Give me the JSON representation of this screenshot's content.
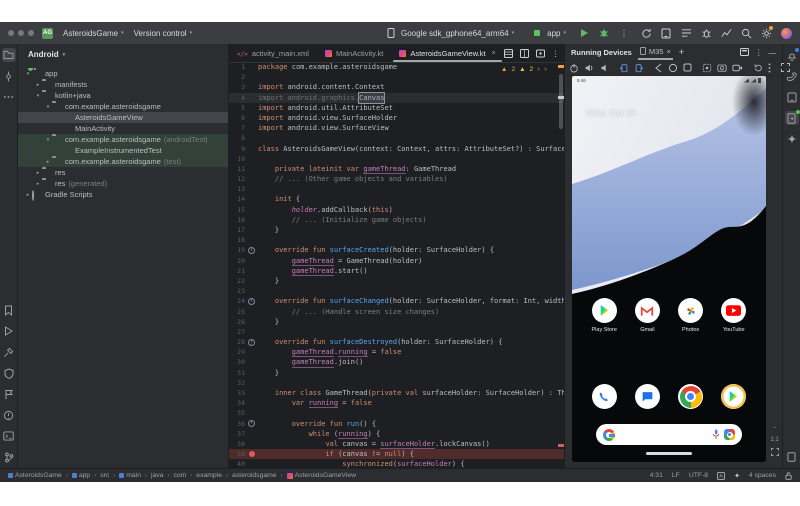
{
  "window": {
    "project": "AsteroidsGame",
    "vcs": "Version control"
  },
  "toolbar": {
    "device": "Google sdk_gphone64_arm64",
    "config": "app",
    "right_icons": [
      "sync",
      "device-manager",
      "build-variants",
      "bug-report",
      "profiler",
      "search",
      "settings"
    ]
  },
  "left_strip": {
    "top": [
      "project",
      "commit",
      "more-tools"
    ],
    "bottom": [
      "bookmarks",
      "run",
      "build",
      "app-quality-insights",
      "logcat",
      "problems",
      "terminal",
      "version-control"
    ]
  },
  "right_strip": {
    "top": [
      "notifications",
      "gradle",
      "device-manager",
      "running-devices",
      "gemini"
    ],
    "bottom": [
      "device-explorer"
    ]
  },
  "project_panel": {
    "title": "Android",
    "tree": [
      {
        "label": "app",
        "meta": "",
        "depth": 0,
        "icon": "app",
        "chev": "open"
      },
      {
        "label": "manifests",
        "meta": "",
        "depth": 1,
        "icon": "folder",
        "chev": "closed"
      },
      {
        "label": "kotlin+java",
        "meta": "",
        "depth": 1,
        "icon": "folder",
        "chev": "open"
      },
      {
        "label": "com.example.asteroidsgame",
        "meta": "",
        "depth": 2,
        "icon": "folder",
        "chev": "open"
      },
      {
        "label": "AsteroidsGameView",
        "meta": "",
        "depth": 3,
        "icon": "kotlin",
        "chev": "",
        "selected": true
      },
      {
        "label": "MainActivity",
        "meta": "",
        "depth": 3,
        "icon": "kotlin",
        "chev": ""
      },
      {
        "label": "com.example.asteroidsgame",
        "meta": "(androidTest)",
        "depth": 2,
        "icon": "folder",
        "chev": "open",
        "test": true
      },
      {
        "label": "ExampleInstrumentedTest",
        "meta": "",
        "depth": 3,
        "icon": "kotlin",
        "chev": "",
        "test": true
      },
      {
        "label": "com.example.asteroidsgame",
        "meta": "(test)",
        "depth": 2,
        "icon": "folder",
        "chev": "closed",
        "test": true
      },
      {
        "label": "res",
        "meta": "",
        "depth": 1,
        "icon": "res",
        "chev": "closed"
      },
      {
        "label": "res",
        "meta": "(generated)",
        "depth": 1,
        "icon": "res",
        "chev": "closed"
      },
      {
        "label": "Gradle Scripts",
        "meta": "",
        "depth": 0,
        "icon": "gradle",
        "chev": "closed"
      }
    ]
  },
  "editor": {
    "tabs": [
      {
        "label": "activity_main.xml",
        "icon": "xml",
        "active": false
      },
      {
        "label": "MainActivity.kt",
        "icon": "kotlin",
        "active": false
      },
      {
        "label": "AsteroidsGameView.kt",
        "icon": "kotlin",
        "active": true,
        "close": "×"
      }
    ],
    "inspections": {
      "warnings": "2",
      "weak_warnings": "2"
    },
    "code": {
      "lines": [
        {
          "n": "1",
          "seg": [
            [
              "k",
              "package"
            ],
            [
              "d",
              " com.example.asteroidsgame"
            ]
          ]
        },
        {
          "n": "2",
          "seg": []
        },
        {
          "n": "3",
          "seg": [
            [
              "k",
              "import"
            ],
            [
              "d",
              " android.content.Context"
            ]
          ]
        },
        {
          "n": "4",
          "hl": "cur",
          "seg": [
            [
              "g",
              "import android.graphics."
            ],
            [
              "gb",
              "Canvas"
            ]
          ]
        },
        {
          "n": "5",
          "seg": [
            [
              "k",
              "import"
            ],
            [
              "d",
              " android.util.AttributeSet"
            ]
          ]
        },
        {
          "n": "6",
          "seg": [
            [
              "k",
              "import"
            ],
            [
              "d",
              " android.view.SurfaceHolder"
            ]
          ]
        },
        {
          "n": "7",
          "seg": [
            [
              "k",
              "import"
            ],
            [
              "d",
              " android.view.SurfaceView"
            ]
          ]
        },
        {
          "n": "8",
          "seg": []
        },
        {
          "n": "9",
          "seg": [
            [
              "k",
              "class"
            ],
            [
              "d",
              " AsteroidsGameView(context: Context, attrs: AttributeSet?) : SurfaceView(context, attrs), SurfaceHolder.Callback {"
            ]
          ]
        },
        {
          "n": "10",
          "seg": []
        },
        {
          "n": "11",
          "seg": [
            [
              "d",
              "    "
            ],
            [
              "k",
              "private lateinit var "
            ],
            [
              "p",
              "gameThread"
            ],
            [
              "d",
              ": GameThread"
            ]
          ]
        },
        {
          "n": "12",
          "seg": [
            [
              "c",
              "    // ... (Other game objects and variables)"
            ]
          ]
        },
        {
          "n": "13",
          "seg": []
        },
        {
          "n": "14",
          "seg": [
            [
              "d",
              "    "
            ],
            [
              "k",
              "init"
            ],
            [
              "d",
              " {"
            ]
          ]
        },
        {
          "n": "15",
          "seg": [
            [
              "d",
              "        "
            ],
            [
              "pi",
              "holder"
            ],
            [
              "d",
              ".addCallback("
            ],
            [
              "k",
              "this"
            ],
            [
              "d",
              ")"
            ]
          ]
        },
        {
          "n": "16",
          "seg": [
            [
              "c",
              "        // ... (Initialize game objects)"
            ]
          ]
        },
        {
          "n": "17",
          "seg": [
            [
              "d",
              "    }"
            ]
          ]
        },
        {
          "n": "18",
          "seg": []
        },
        {
          "n": "19",
          "g": "ov",
          "seg": [
            [
              "d",
              "    "
            ],
            [
              "k",
              "override fun "
            ],
            [
              "f",
              "surfaceCreated"
            ],
            [
              "d",
              "(holder: SurfaceHolder) {"
            ]
          ]
        },
        {
          "n": "20",
          "seg": [
            [
              "d",
              "        "
            ],
            [
              "p",
              "gameThread"
            ],
            [
              "d",
              " = GameThread(holder)"
            ]
          ]
        },
        {
          "n": "21",
          "seg": [
            [
              "d",
              "        "
            ],
            [
              "p",
              "gameThread"
            ],
            [
              "d",
              ".start()"
            ]
          ]
        },
        {
          "n": "22",
          "seg": [
            [
              "d",
              "    }"
            ]
          ]
        },
        {
          "n": "23",
          "seg": []
        },
        {
          "n": "24",
          "g": "ov",
          "seg": [
            [
              "d",
              "    "
            ],
            [
              "k",
              "override fun "
            ],
            [
              "f",
              "surfaceChanged"
            ],
            [
              "d",
              "(holder: SurfaceHolder, format: Int, width: Int, height: Int) {"
            ]
          ]
        },
        {
          "n": "25",
          "seg": [
            [
              "c",
              "        // ... (Handle screen size changes)"
            ]
          ]
        },
        {
          "n": "26",
          "seg": [
            [
              "d",
              "    }"
            ]
          ]
        },
        {
          "n": "27",
          "seg": []
        },
        {
          "n": "28",
          "g": "ov",
          "seg": [
            [
              "d",
              "    "
            ],
            [
              "k",
              "override fun "
            ],
            [
              "f",
              "surfaceDestroyed"
            ],
            [
              "d",
              "(holder: SurfaceHolder) {"
            ]
          ]
        },
        {
          "n": "29",
          "seg": [
            [
              "d",
              "        "
            ],
            [
              "p",
              "gameThread"
            ],
            [
              "d",
              "."
            ],
            [
              "p",
              "running"
            ],
            [
              "d",
              " = "
            ],
            [
              "k",
              "false"
            ]
          ]
        },
        {
          "n": "30",
          "seg": [
            [
              "d",
              "        "
            ],
            [
              "p",
              "gameThread"
            ],
            [
              "d",
              ".join()"
            ]
          ]
        },
        {
          "n": "31",
          "seg": [
            [
              "d",
              "    }"
            ]
          ]
        },
        {
          "n": "32",
          "seg": []
        },
        {
          "n": "33",
          "seg": [
            [
              "d",
              "    "
            ],
            [
              "k",
              "inner class "
            ],
            [
              "d",
              "GameThread("
            ],
            [
              "k",
              "private val "
            ],
            [
              "d",
              "surfaceHolder: SurfaceHolder) : Thread() {"
            ]
          ]
        },
        {
          "n": "34",
          "seg": [
            [
              "d",
              "        "
            ],
            [
              "k",
              "var "
            ],
            [
              "p",
              "running"
            ],
            [
              "d",
              " = "
            ],
            [
              "k",
              "false"
            ]
          ]
        },
        {
          "n": "35",
          "seg": []
        },
        {
          "n": "36",
          "g": "ov",
          "seg": [
            [
              "d",
              "        "
            ],
            [
              "k",
              "override fun "
            ],
            [
              "f",
              "run"
            ],
            [
              "d",
              "() {"
            ]
          ]
        },
        {
          "n": "37",
          "seg": [
            [
              "d",
              "            "
            ],
            [
              "k",
              "while"
            ],
            [
              "d",
              " ("
            ],
            [
              "p",
              "running"
            ],
            [
              "d",
              ") {"
            ]
          ]
        },
        {
          "n": "38",
          "seg": [
            [
              "d",
              "                "
            ],
            [
              "k",
              "val "
            ],
            [
              "d",
              "canvas = "
            ],
            [
              "p",
              "surfaceHolder"
            ],
            [
              "d",
              ".lockCanvas()"
            ]
          ]
        },
        {
          "n": "39",
          "g": "bp",
          "hl": "bp",
          "seg": [
            [
              "d",
              "                "
            ],
            [
              "k",
              "if"
            ],
            [
              "d",
              " (canvas != "
            ],
            [
              "k",
              "null"
            ],
            [
              "d",
              ") {"
            ]
          ]
        },
        {
          "n": "40",
          "seg": [
            [
              "d",
              "                    "
            ],
            [
              "k",
              "synchronized"
            ],
            [
              "d",
              "("
            ],
            [
              "p",
              "surfaceHolder"
            ],
            [
              "d",
              ") {"
            ]
          ]
        }
      ]
    }
  },
  "device_panel": {
    "title": "Running Devices",
    "tab": "M35",
    "add": "+",
    "toolbar": [
      "power",
      "volume-up",
      "volume-down",
      "|",
      "rotate-left",
      "rotate-right",
      "|",
      "back",
      "home",
      "overview",
      "|",
      "snapshot",
      "screenshot",
      "record",
      "|",
      "reset",
      "more"
    ],
    "phone": {
      "time": "5:46",
      "date": "Wed, Oct 16",
      "apps": [
        {
          "name": "Play Store",
          "icon": "playstore"
        },
        {
          "name": "Gmail",
          "icon": "gmail"
        },
        {
          "name": "Photos",
          "icon": "photos"
        },
        {
          "name": "YouTube",
          "icon": "youtube"
        }
      ],
      "dock": [
        {
          "name": "Phone",
          "icon": "phoneapp"
        },
        {
          "name": "Messages",
          "icon": "messages"
        },
        {
          "name": "Chrome",
          "icon": "chrome"
        },
        {
          "name": "Play Store",
          "icon": "playgold"
        }
      ]
    },
    "zoom": {
      "out": "−",
      "ratio": "1:1"
    }
  },
  "status_bar": {
    "breadcrumbs": [
      {
        "t": "AsteroidsGame",
        "icon": "module"
      },
      {
        "t": "app",
        "icon": "module"
      },
      {
        "t": "src",
        "icon": ""
      },
      {
        "t": "main",
        "icon": "module"
      },
      {
        "t": "java",
        "icon": ""
      },
      {
        "t": "com",
        "icon": ""
      },
      {
        "t": "example",
        "icon": ""
      },
      {
        "t": "asteroidsgame",
        "icon": ""
      },
      {
        "t": "AsteroidsGameView",
        "icon": "kotlin"
      }
    ],
    "cursor": "4:31",
    "line_sep": "LF",
    "encoding": "UTF-8",
    "indent": "4 spaces"
  }
}
